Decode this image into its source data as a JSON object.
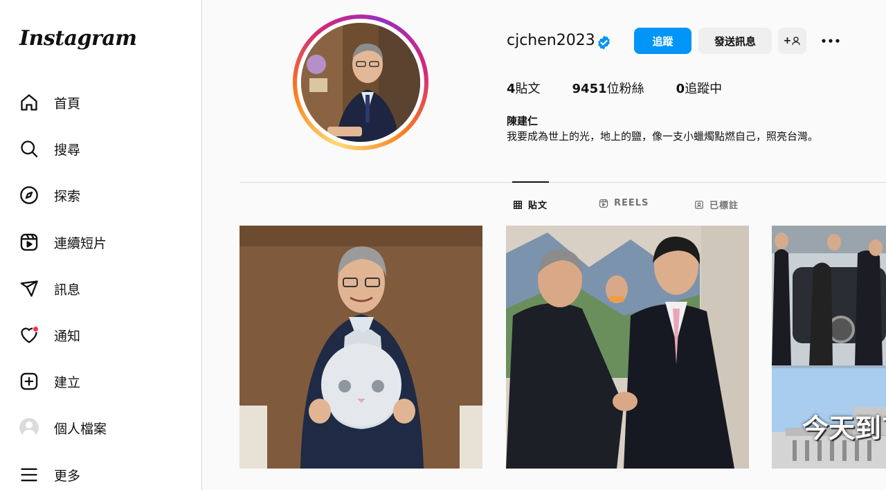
{
  "app": {
    "logo": "Instagram"
  },
  "sidebar": {
    "items": [
      {
        "label": "首頁",
        "icon": "home-icon"
      },
      {
        "label": "搜尋",
        "icon": "search-icon"
      },
      {
        "label": "探索",
        "icon": "compass-icon"
      },
      {
        "label": "連續短片",
        "icon": "reels-icon"
      },
      {
        "label": "訊息",
        "icon": "send-icon"
      },
      {
        "label": "通知",
        "icon": "heart-icon"
      },
      {
        "label": "建立",
        "icon": "plus-square-icon"
      },
      {
        "label": "個人檔案",
        "icon": "avatar"
      },
      {
        "label": "更多",
        "icon": "menu-icon"
      }
    ]
  },
  "profile": {
    "username": "cjchen2023",
    "verified": true,
    "follow_label": "追蹤",
    "message_label": "發送訊息",
    "add_label": "+",
    "stats": {
      "posts_count": "4",
      "posts_label": "貼文",
      "followers_count": "9451",
      "followers_label": "位粉絲",
      "following_count": "0",
      "following_label": "追蹤中"
    },
    "full_name": "陳建仁",
    "bio": "我要成為世上的光，地上的鹽，像一支小蠟燭點燃自己，照亮台灣。"
  },
  "tabs": [
    {
      "label": "貼文",
      "active": true
    },
    {
      "label": "REELS",
      "active": false
    },
    {
      "label": "已標註",
      "active": false
    }
  ],
  "posts": [
    {
      "description": "photo"
    },
    {
      "description": "photo"
    },
    {
      "overlay_text": "今天到ㄒ"
    }
  ],
  "colors": {
    "accent": "#0095f6",
    "notification": "#ff3040"
  }
}
